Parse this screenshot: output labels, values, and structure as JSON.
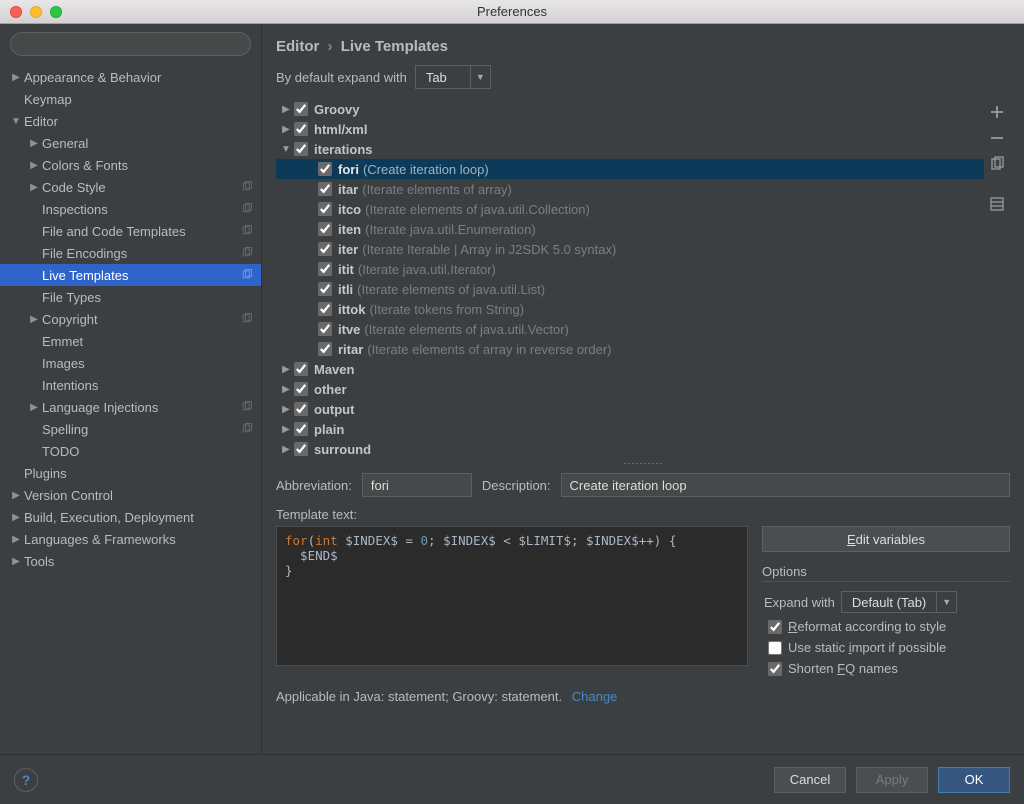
{
  "window": {
    "title": "Preferences"
  },
  "search": {
    "placeholder": ""
  },
  "sidebar": {
    "items": [
      {
        "label": "Appearance & Behavior",
        "depth": 0,
        "expandable": true,
        "expanded": false,
        "copyable": false,
        "selected": false
      },
      {
        "label": "Keymap",
        "depth": 0,
        "expandable": false,
        "expanded": false,
        "copyable": false,
        "selected": false
      },
      {
        "label": "Editor",
        "depth": 0,
        "expandable": true,
        "expanded": true,
        "copyable": false,
        "selected": false
      },
      {
        "label": "General",
        "depth": 1,
        "expandable": true,
        "expanded": false,
        "copyable": false,
        "selected": false
      },
      {
        "label": "Colors & Fonts",
        "depth": 1,
        "expandable": true,
        "expanded": false,
        "copyable": false,
        "selected": false
      },
      {
        "label": "Code Style",
        "depth": 1,
        "expandable": true,
        "expanded": false,
        "copyable": true,
        "selected": false
      },
      {
        "label": "Inspections",
        "depth": 1,
        "expandable": false,
        "expanded": false,
        "copyable": true,
        "selected": false
      },
      {
        "label": "File and Code Templates",
        "depth": 1,
        "expandable": false,
        "expanded": false,
        "copyable": true,
        "selected": false
      },
      {
        "label": "File Encodings",
        "depth": 1,
        "expandable": false,
        "expanded": false,
        "copyable": true,
        "selected": false
      },
      {
        "label": "Live Templates",
        "depth": 1,
        "expandable": false,
        "expanded": false,
        "copyable": true,
        "selected": true
      },
      {
        "label": "File Types",
        "depth": 1,
        "expandable": false,
        "expanded": false,
        "copyable": false,
        "selected": false
      },
      {
        "label": "Copyright",
        "depth": 1,
        "expandable": true,
        "expanded": false,
        "copyable": true,
        "selected": false
      },
      {
        "label": "Emmet",
        "depth": 1,
        "expandable": false,
        "expanded": false,
        "copyable": false,
        "selected": false
      },
      {
        "label": "Images",
        "depth": 1,
        "expandable": false,
        "expanded": false,
        "copyable": false,
        "selected": false
      },
      {
        "label": "Intentions",
        "depth": 1,
        "expandable": false,
        "expanded": false,
        "copyable": false,
        "selected": false
      },
      {
        "label": "Language Injections",
        "depth": 1,
        "expandable": true,
        "expanded": false,
        "copyable": true,
        "selected": false
      },
      {
        "label": "Spelling",
        "depth": 1,
        "expandable": false,
        "expanded": false,
        "copyable": true,
        "selected": false
      },
      {
        "label": "TODO",
        "depth": 1,
        "expandable": false,
        "expanded": false,
        "copyable": false,
        "selected": false
      },
      {
        "label": "Plugins",
        "depth": 0,
        "expandable": false,
        "expanded": false,
        "copyable": false,
        "selected": false
      },
      {
        "label": "Version Control",
        "depth": 0,
        "expandable": true,
        "expanded": false,
        "copyable": false,
        "selected": false
      },
      {
        "label": "Build, Execution, Deployment",
        "depth": 0,
        "expandable": true,
        "expanded": false,
        "copyable": false,
        "selected": false
      },
      {
        "label": "Languages & Frameworks",
        "depth": 0,
        "expandable": true,
        "expanded": false,
        "copyable": false,
        "selected": false
      },
      {
        "label": "Tools",
        "depth": 0,
        "expandable": true,
        "expanded": false,
        "copyable": false,
        "selected": false
      }
    ]
  },
  "breadcrumb": {
    "a": "Editor",
    "b": "Live Templates"
  },
  "expand_default": {
    "label": "By default expand with",
    "value": "Tab"
  },
  "template_tree": [
    {
      "type": "group",
      "label": "Groovy",
      "expanded": false,
      "checked": true,
      "depth": 0
    },
    {
      "type": "group",
      "label": "html/xml",
      "expanded": false,
      "checked": true,
      "depth": 0
    },
    {
      "type": "group",
      "label": "iterations",
      "expanded": true,
      "checked": true,
      "depth": 0
    },
    {
      "type": "item",
      "abbr": "fori",
      "desc": "(Create iteration loop)",
      "checked": true,
      "depth": 1,
      "selected": true
    },
    {
      "type": "item",
      "abbr": "itar",
      "desc": "(Iterate elements of array)",
      "checked": true,
      "depth": 1,
      "selected": false
    },
    {
      "type": "item",
      "abbr": "itco",
      "desc": "(Iterate elements of java.util.Collection)",
      "checked": true,
      "depth": 1,
      "selected": false
    },
    {
      "type": "item",
      "abbr": "iten",
      "desc": "(Iterate java.util.Enumeration)",
      "checked": true,
      "depth": 1,
      "selected": false
    },
    {
      "type": "item",
      "abbr": "iter",
      "desc": "(Iterate Iterable | Array in J2SDK 5.0 syntax)",
      "checked": true,
      "depth": 1,
      "selected": false
    },
    {
      "type": "item",
      "abbr": "itit",
      "desc": "(Iterate java.util.Iterator)",
      "checked": true,
      "depth": 1,
      "selected": false
    },
    {
      "type": "item",
      "abbr": "itli",
      "desc": "(Iterate elements of java.util.List)",
      "checked": true,
      "depth": 1,
      "selected": false
    },
    {
      "type": "item",
      "abbr": "ittok",
      "desc": "(Iterate tokens from String)",
      "checked": true,
      "depth": 1,
      "selected": false
    },
    {
      "type": "item",
      "abbr": "itve",
      "desc": "(Iterate elements of java.util.Vector)",
      "checked": true,
      "depth": 1,
      "selected": false
    },
    {
      "type": "item",
      "abbr": "ritar",
      "desc": "(Iterate elements of array in reverse order)",
      "checked": true,
      "depth": 1,
      "selected": false
    },
    {
      "type": "group",
      "label": "Maven",
      "expanded": false,
      "checked": true,
      "depth": 0
    },
    {
      "type": "group",
      "label": "other",
      "expanded": false,
      "checked": true,
      "depth": 0
    },
    {
      "type": "group",
      "label": "output",
      "expanded": false,
      "checked": true,
      "depth": 0
    },
    {
      "type": "group",
      "label": "plain",
      "expanded": false,
      "checked": true,
      "depth": 0
    },
    {
      "type": "group",
      "label": "surround",
      "expanded": false,
      "checked": true,
      "depth": 0
    }
  ],
  "form": {
    "abbr_label": "Abbreviation:",
    "abbr_value": "fori",
    "desc_label": "Description:",
    "desc_value": "Create iteration loop",
    "tmpl_label": "Template text:"
  },
  "code": {
    "l1a": "for",
    "l1b": "int",
    "l1c": " $INDEX$ = ",
    "l1d": "0",
    "l1e": "; $INDEX$ < $LIMIT$; $INDEX$++) {",
    "l2": "  $END$",
    "l3": "}"
  },
  "editvars_btn": "Edit variables",
  "options": {
    "header": "Options",
    "expand_label": "Expand with",
    "expand_value": "Default (Tab)",
    "reformat": "Reformat according to style",
    "static_import": "Use static import if possible",
    "shorten_fq": "Shorten FQ names"
  },
  "applicable": {
    "text": "Applicable in Java: statement; Groovy: statement.",
    "change": "Change"
  },
  "footer": {
    "cancel": "Cancel",
    "apply": "Apply",
    "ok": "OK"
  }
}
